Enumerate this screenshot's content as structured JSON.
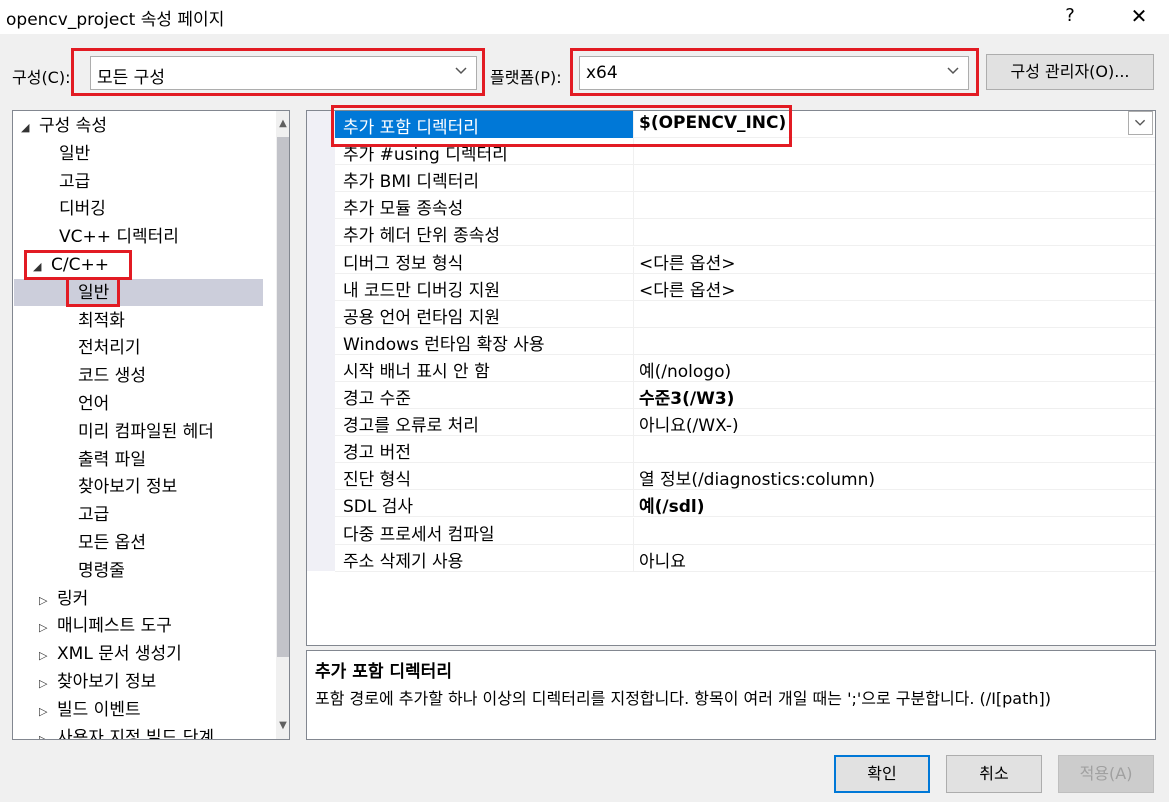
{
  "window": {
    "title": "opencv_project 속성 페이지",
    "help_label": "?",
    "close_label": "✕"
  },
  "config": {
    "configuration_label": "구성(C):",
    "configuration_value": "모든 구성",
    "platform_label": "플랫폼(P):",
    "platform_value": "x64",
    "manager_button": "구성 관리자(O)..."
  },
  "tree": {
    "items": [
      {
        "label": "구성 속성",
        "arrow": "◢"
      },
      {
        "label": "일반"
      },
      {
        "label": "고급"
      },
      {
        "label": "디버깅"
      },
      {
        "label": "VC++ 디렉터리"
      },
      {
        "label": "C/C++",
        "arrow": "◢"
      },
      {
        "label": "일반"
      },
      {
        "label": "최적화"
      },
      {
        "label": "전처리기"
      },
      {
        "label": "코드 생성"
      },
      {
        "label": "언어"
      },
      {
        "label": "미리 컴파일된 헤더"
      },
      {
        "label": "출력 파일"
      },
      {
        "label": "찾아보기 정보"
      },
      {
        "label": "고급"
      },
      {
        "label": "모든 옵션"
      },
      {
        "label": "명령줄"
      },
      {
        "label": "링커",
        "arrow": "▷"
      },
      {
        "label": "매니페스트 도구",
        "arrow": "▷"
      },
      {
        "label": "XML 문서 생성기",
        "arrow": "▷"
      },
      {
        "label": "찾아보기 정보",
        "arrow": "▷"
      },
      {
        "label": "빌드 이벤트",
        "arrow": "▷"
      },
      {
        "label": "사용자 지정 빌드 단계",
        "arrow": "▷"
      }
    ]
  },
  "properties": {
    "rows": [
      {
        "name": "추가 포함 디렉터리",
        "value": "$(OPENCV_INC)"
      },
      {
        "name": "추가 #using 디렉터리",
        "value": ""
      },
      {
        "name": "추가 BMI 디렉터리",
        "value": ""
      },
      {
        "name": "추가 모듈 종속성",
        "value": ""
      },
      {
        "name": "추가 헤더 단위 종속성",
        "value": ""
      },
      {
        "name": "디버그 정보 형식",
        "value": "<다른 옵션>"
      },
      {
        "name": "내 코드만 디버깅 지원",
        "value": "<다른 옵션>"
      },
      {
        "name": "공용 언어 런타임 지원",
        "value": ""
      },
      {
        "name": "Windows 런타임 확장 사용",
        "value": ""
      },
      {
        "name": "시작 배너 표시 안 함",
        "value": "예(/nologo)"
      },
      {
        "name": "경고 수준",
        "value": "수준3(/W3)"
      },
      {
        "name": "경고를 오류로 처리",
        "value": "아니요(/WX-)"
      },
      {
        "name": "경고 버전",
        "value": ""
      },
      {
        "name": "진단 형식",
        "value": "열 정보(/diagnostics:column)"
      },
      {
        "name": "SDL 검사",
        "value": "예(/sdl)"
      },
      {
        "name": "다중 프로세서 컴파일",
        "value": ""
      },
      {
        "name": "주소 삭제기 사용",
        "value": "아니요"
      }
    ]
  },
  "description": {
    "title": "추가 포함 디렉터리",
    "text": "포함 경로에 추가할 하나 이상의 디렉터리를 지정합니다. 항목이 여러 개일 때는 ';'으로 구분합니다. (/I[path])"
  },
  "footer": {
    "ok": "확인",
    "cancel": "취소",
    "apply": "적용(A)"
  },
  "colors": {
    "highlight": "#e21b23",
    "selection": "#0078d7"
  }
}
